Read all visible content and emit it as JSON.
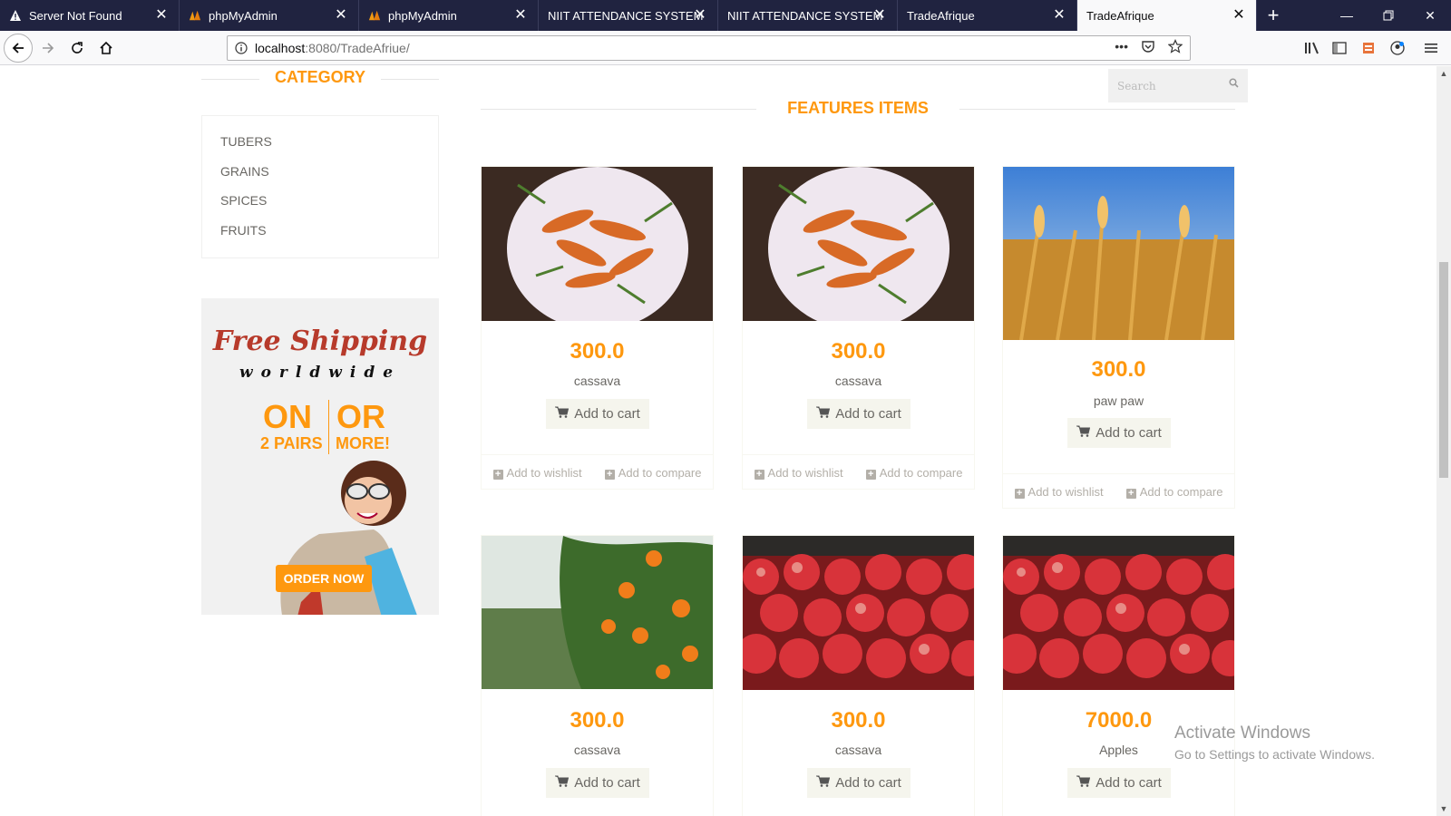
{
  "tabs": [
    {
      "label": "Server Not Found",
      "icon": "warning-icon",
      "active": false
    },
    {
      "label": "phpMyAdmin",
      "icon": "phpmyadmin-icon",
      "active": false
    },
    {
      "label": "phpMyAdmin",
      "icon": "phpmyadmin-icon",
      "active": false
    },
    {
      "label": "NIIT ATTENDANCE SYSTEM",
      "icon": "",
      "active": false
    },
    {
      "label": "NIIT ATTENDANCE SYSTEM",
      "icon": "",
      "active": false
    },
    {
      "label": "TradeAfrique",
      "icon": "",
      "active": false
    },
    {
      "label": "TradeAfrique",
      "icon": "",
      "active": true
    }
  ],
  "url": {
    "host": "localhost",
    "path": ":8080/TradeAfriue/"
  },
  "sidebar": {
    "category_title": "CATEGORY",
    "categories": [
      "TUBERS",
      "GRAINS",
      "SPICES",
      "FRUITS"
    ],
    "ad": {
      "free": "Free Shipping",
      "worldwide": "worldwide",
      "on": "ON",
      "or": "OR",
      "pairs": "2 PAIRS",
      "more": "MORE!",
      "order": "ORDER NOW"
    }
  },
  "search": {
    "placeholder": "Search"
  },
  "main": {
    "title": "FEATURES ITEMS",
    "wishlist": "Add to wishlist",
    "compare": "Add to compare",
    "cart": "Add to cart",
    "products": [
      {
        "price": "300.0",
        "name": "cassava",
        "image": "carrots"
      },
      {
        "price": "300.0",
        "name": "cassava",
        "image": "carrots"
      },
      {
        "price": "300.0",
        "name": "paw paw",
        "image": "wheat"
      },
      {
        "price": "300.0",
        "name": "cassava",
        "image": "oranges"
      },
      {
        "price": "300.0",
        "name": "cassava",
        "image": "apples"
      },
      {
        "price": "7000.0",
        "name": "Apples",
        "image": "apples"
      }
    ]
  },
  "watermark": {
    "line1": "Activate Windows",
    "line2": "Go to Settings to activate Windows."
  },
  "colors": {
    "accent": "#fe980f",
    "tabbar": "#202340"
  }
}
